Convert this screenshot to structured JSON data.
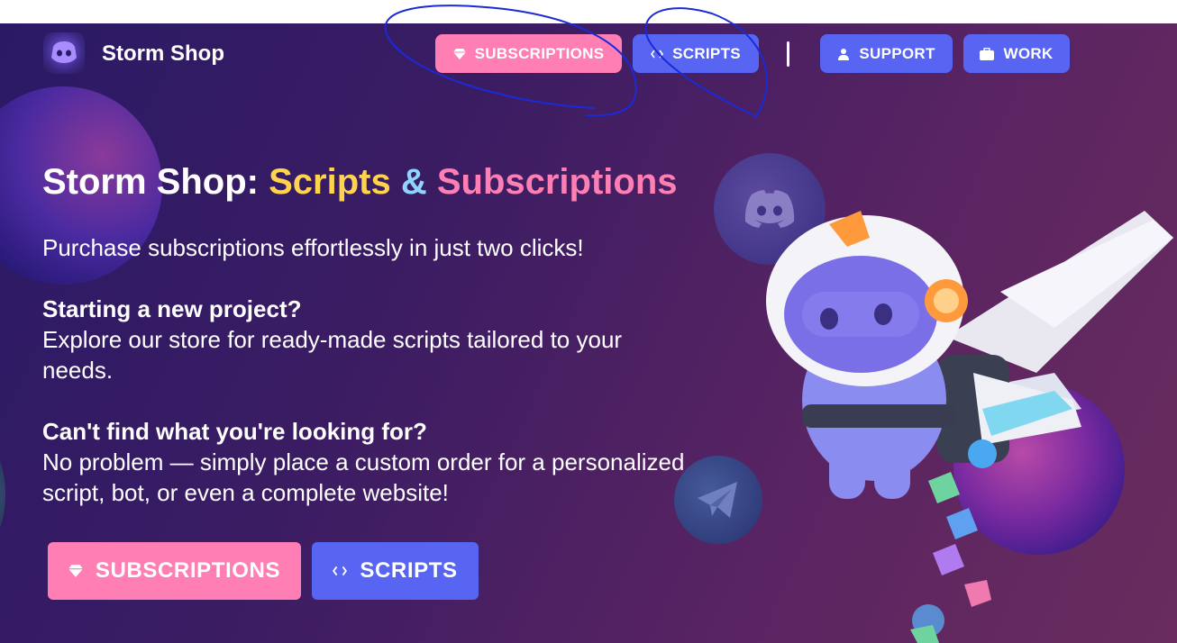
{
  "header": {
    "brand": "Storm Shop",
    "nav": {
      "subscriptions": "SUBSCRIPTIONS",
      "scripts": "SCRIPTS",
      "support": "SUPPORT",
      "work": "WORK"
    }
  },
  "hero": {
    "title_prefix": "Storm Shop: ",
    "title_scripts": "Scripts",
    "title_amp": " & ",
    "title_subscriptions": "Subscriptions",
    "intro": "Purchase subscriptions effortlessly in just two clicks!",
    "q1_heading": "Starting a new project?",
    "q1_body": "Explore our store for ready-made scripts tailored to your needs.",
    "q2_heading": "Can't find what you're looking for?",
    "q2_body": "No problem — simply place a custom order for a personalized script, bot, or even a complete website!",
    "cta_subscriptions": "SUBSCRIPTIONS",
    "cta_scripts": "SCRIPTS"
  },
  "colors": {
    "pink": "#ff7eb3",
    "blue": "#5865f2",
    "yellow": "#ffd44d",
    "light_blue": "#8fd3ff"
  },
  "icons": [
    "diamond-icon",
    "code-icon",
    "user-icon",
    "briefcase-icon",
    "discord-icon",
    "telegram-icon"
  ]
}
